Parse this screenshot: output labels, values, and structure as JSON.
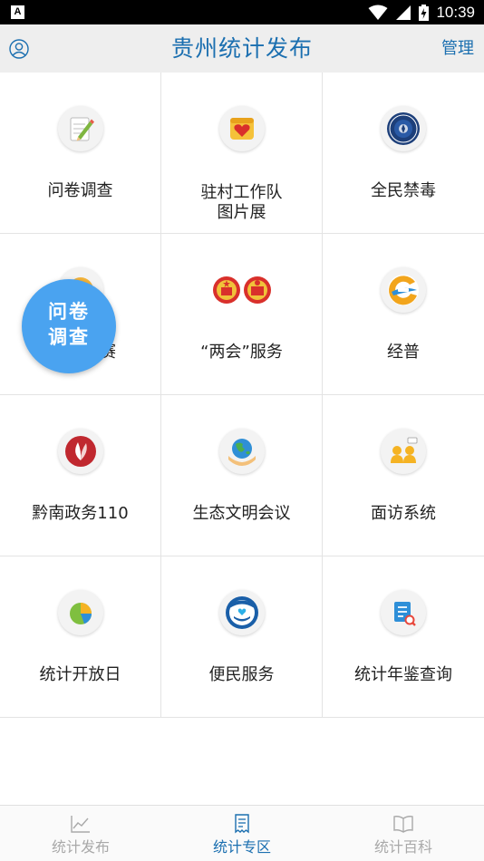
{
  "status_bar": {
    "app_badge": "A",
    "time": "10:39"
  },
  "header": {
    "title": "贵州统计发布",
    "manage_label": "管理"
  },
  "grid": {
    "rows": [
      [
        {
          "label": "问卷调查",
          "icon": "pencil-icon"
        },
        {
          "label": "驻村工作队\n图片展",
          "icon": "heart-icon"
        },
        {
          "label": "全民禁毒",
          "icon": "anti-drug-emblem-icon"
        }
      ],
      [
        {
          "label": "…赛",
          "icon": "contest-icon"
        },
        {
          "label": "“两会”服务",
          "icon": "national-emblem-icon"
        },
        {
          "label": "经普",
          "icon": "census-logo-icon"
        }
      ],
      [
        {
          "label": "黔南政务110",
          "icon": "leaf-emblem-icon"
        },
        {
          "label": "生态文明会议",
          "icon": "earth-hands-icon"
        },
        {
          "label": "面访系统",
          "icon": "interview-people-icon"
        }
      ],
      [
        {
          "label": "统计开放日",
          "icon": "pie-chart-icon"
        },
        {
          "label": "便民服务",
          "icon": "service-badge-icon"
        },
        {
          "label": "统计年鉴查询",
          "icon": "document-search-icon"
        }
      ]
    ]
  },
  "fab": {
    "line1": "问卷",
    "line2": "调查"
  },
  "bottom_nav": {
    "items": [
      {
        "label": "统计发布",
        "icon": "line-chart-icon",
        "active": false
      },
      {
        "label": "统计专区",
        "icon": "receipt-icon",
        "active": true
      },
      {
        "label": "统计百科",
        "icon": "open-book-icon",
        "active": false
      }
    ]
  },
  "colors": {
    "accent": "#1b6fb0",
    "fab": "#4aa3f0",
    "inactive": "#a9a9a9",
    "header_bg": "#eeeeee"
  }
}
